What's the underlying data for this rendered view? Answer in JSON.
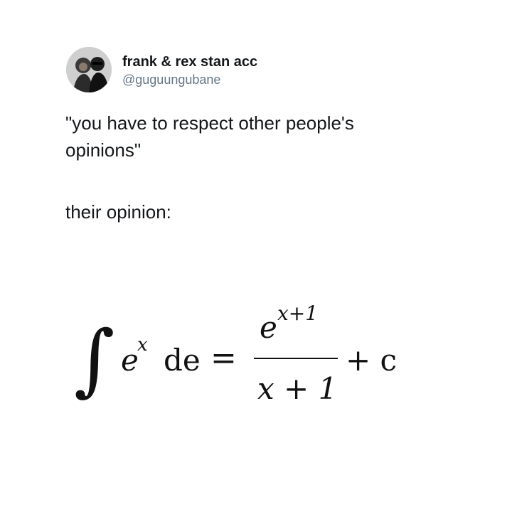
{
  "tweet": {
    "display_name": "frank & rex stan acc",
    "handle": "@guguungubane",
    "text_line1": "\"you have to respect other people's",
    "text_line2": "opinions\"",
    "text_line3": "their opinion:"
  },
  "equation": {
    "integral_sign": "∫",
    "integrand_base": "e",
    "integrand_exponent": "x",
    "differential": "de",
    "equals": "=",
    "numerator_base": "e",
    "numerator_exponent": "x+1",
    "denominator": "x + 1",
    "constant": "+ c"
  }
}
